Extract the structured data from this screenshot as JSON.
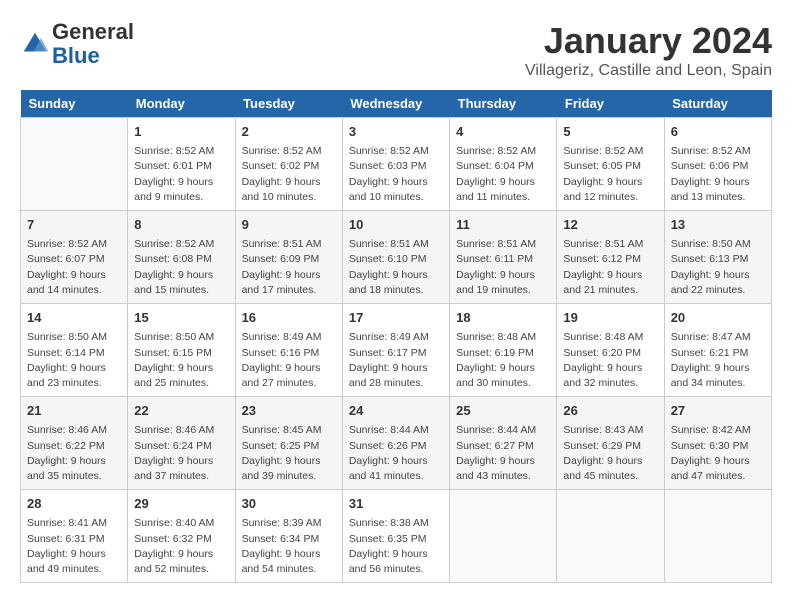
{
  "header": {
    "logo_line1": "General",
    "logo_line2": "Blue",
    "month": "January 2024",
    "location": "Villageriz, Castille and Leon, Spain"
  },
  "weekdays": [
    "Sunday",
    "Monday",
    "Tuesday",
    "Wednesday",
    "Thursday",
    "Friday",
    "Saturday"
  ],
  "weeks": [
    [
      {
        "num": "",
        "info": ""
      },
      {
        "num": "1",
        "info": "Sunrise: 8:52 AM\nSunset: 6:01 PM\nDaylight: 9 hours\nand 9 minutes."
      },
      {
        "num": "2",
        "info": "Sunrise: 8:52 AM\nSunset: 6:02 PM\nDaylight: 9 hours\nand 10 minutes."
      },
      {
        "num": "3",
        "info": "Sunrise: 8:52 AM\nSunset: 6:03 PM\nDaylight: 9 hours\nand 10 minutes."
      },
      {
        "num": "4",
        "info": "Sunrise: 8:52 AM\nSunset: 6:04 PM\nDaylight: 9 hours\nand 11 minutes."
      },
      {
        "num": "5",
        "info": "Sunrise: 8:52 AM\nSunset: 6:05 PM\nDaylight: 9 hours\nand 12 minutes."
      },
      {
        "num": "6",
        "info": "Sunrise: 8:52 AM\nSunset: 6:06 PM\nDaylight: 9 hours\nand 13 minutes."
      }
    ],
    [
      {
        "num": "7",
        "info": "Sunrise: 8:52 AM\nSunset: 6:07 PM\nDaylight: 9 hours\nand 14 minutes."
      },
      {
        "num": "8",
        "info": "Sunrise: 8:52 AM\nSunset: 6:08 PM\nDaylight: 9 hours\nand 15 minutes."
      },
      {
        "num": "9",
        "info": "Sunrise: 8:51 AM\nSunset: 6:09 PM\nDaylight: 9 hours\nand 17 minutes."
      },
      {
        "num": "10",
        "info": "Sunrise: 8:51 AM\nSunset: 6:10 PM\nDaylight: 9 hours\nand 18 minutes."
      },
      {
        "num": "11",
        "info": "Sunrise: 8:51 AM\nSunset: 6:11 PM\nDaylight: 9 hours\nand 19 minutes."
      },
      {
        "num": "12",
        "info": "Sunrise: 8:51 AM\nSunset: 6:12 PM\nDaylight: 9 hours\nand 21 minutes."
      },
      {
        "num": "13",
        "info": "Sunrise: 8:50 AM\nSunset: 6:13 PM\nDaylight: 9 hours\nand 22 minutes."
      }
    ],
    [
      {
        "num": "14",
        "info": "Sunrise: 8:50 AM\nSunset: 6:14 PM\nDaylight: 9 hours\nand 23 minutes."
      },
      {
        "num": "15",
        "info": "Sunrise: 8:50 AM\nSunset: 6:15 PM\nDaylight: 9 hours\nand 25 minutes."
      },
      {
        "num": "16",
        "info": "Sunrise: 8:49 AM\nSunset: 6:16 PM\nDaylight: 9 hours\nand 27 minutes."
      },
      {
        "num": "17",
        "info": "Sunrise: 8:49 AM\nSunset: 6:17 PM\nDaylight: 9 hours\nand 28 minutes."
      },
      {
        "num": "18",
        "info": "Sunrise: 8:48 AM\nSunset: 6:19 PM\nDaylight: 9 hours\nand 30 minutes."
      },
      {
        "num": "19",
        "info": "Sunrise: 8:48 AM\nSunset: 6:20 PM\nDaylight: 9 hours\nand 32 minutes."
      },
      {
        "num": "20",
        "info": "Sunrise: 8:47 AM\nSunset: 6:21 PM\nDaylight: 9 hours\nand 34 minutes."
      }
    ],
    [
      {
        "num": "21",
        "info": "Sunrise: 8:46 AM\nSunset: 6:22 PM\nDaylight: 9 hours\nand 35 minutes."
      },
      {
        "num": "22",
        "info": "Sunrise: 8:46 AM\nSunset: 6:24 PM\nDaylight: 9 hours\nand 37 minutes."
      },
      {
        "num": "23",
        "info": "Sunrise: 8:45 AM\nSunset: 6:25 PM\nDaylight: 9 hours\nand 39 minutes."
      },
      {
        "num": "24",
        "info": "Sunrise: 8:44 AM\nSunset: 6:26 PM\nDaylight: 9 hours\nand 41 minutes."
      },
      {
        "num": "25",
        "info": "Sunrise: 8:44 AM\nSunset: 6:27 PM\nDaylight: 9 hours\nand 43 minutes."
      },
      {
        "num": "26",
        "info": "Sunrise: 8:43 AM\nSunset: 6:29 PM\nDaylight: 9 hours\nand 45 minutes."
      },
      {
        "num": "27",
        "info": "Sunrise: 8:42 AM\nSunset: 6:30 PM\nDaylight: 9 hours\nand 47 minutes."
      }
    ],
    [
      {
        "num": "28",
        "info": "Sunrise: 8:41 AM\nSunset: 6:31 PM\nDaylight: 9 hours\nand 49 minutes."
      },
      {
        "num": "29",
        "info": "Sunrise: 8:40 AM\nSunset: 6:32 PM\nDaylight: 9 hours\nand 52 minutes."
      },
      {
        "num": "30",
        "info": "Sunrise: 8:39 AM\nSunset: 6:34 PM\nDaylight: 9 hours\nand 54 minutes."
      },
      {
        "num": "31",
        "info": "Sunrise: 8:38 AM\nSunset: 6:35 PM\nDaylight: 9 hours\nand 56 minutes."
      },
      {
        "num": "",
        "info": ""
      },
      {
        "num": "",
        "info": ""
      },
      {
        "num": "",
        "info": ""
      }
    ]
  ]
}
